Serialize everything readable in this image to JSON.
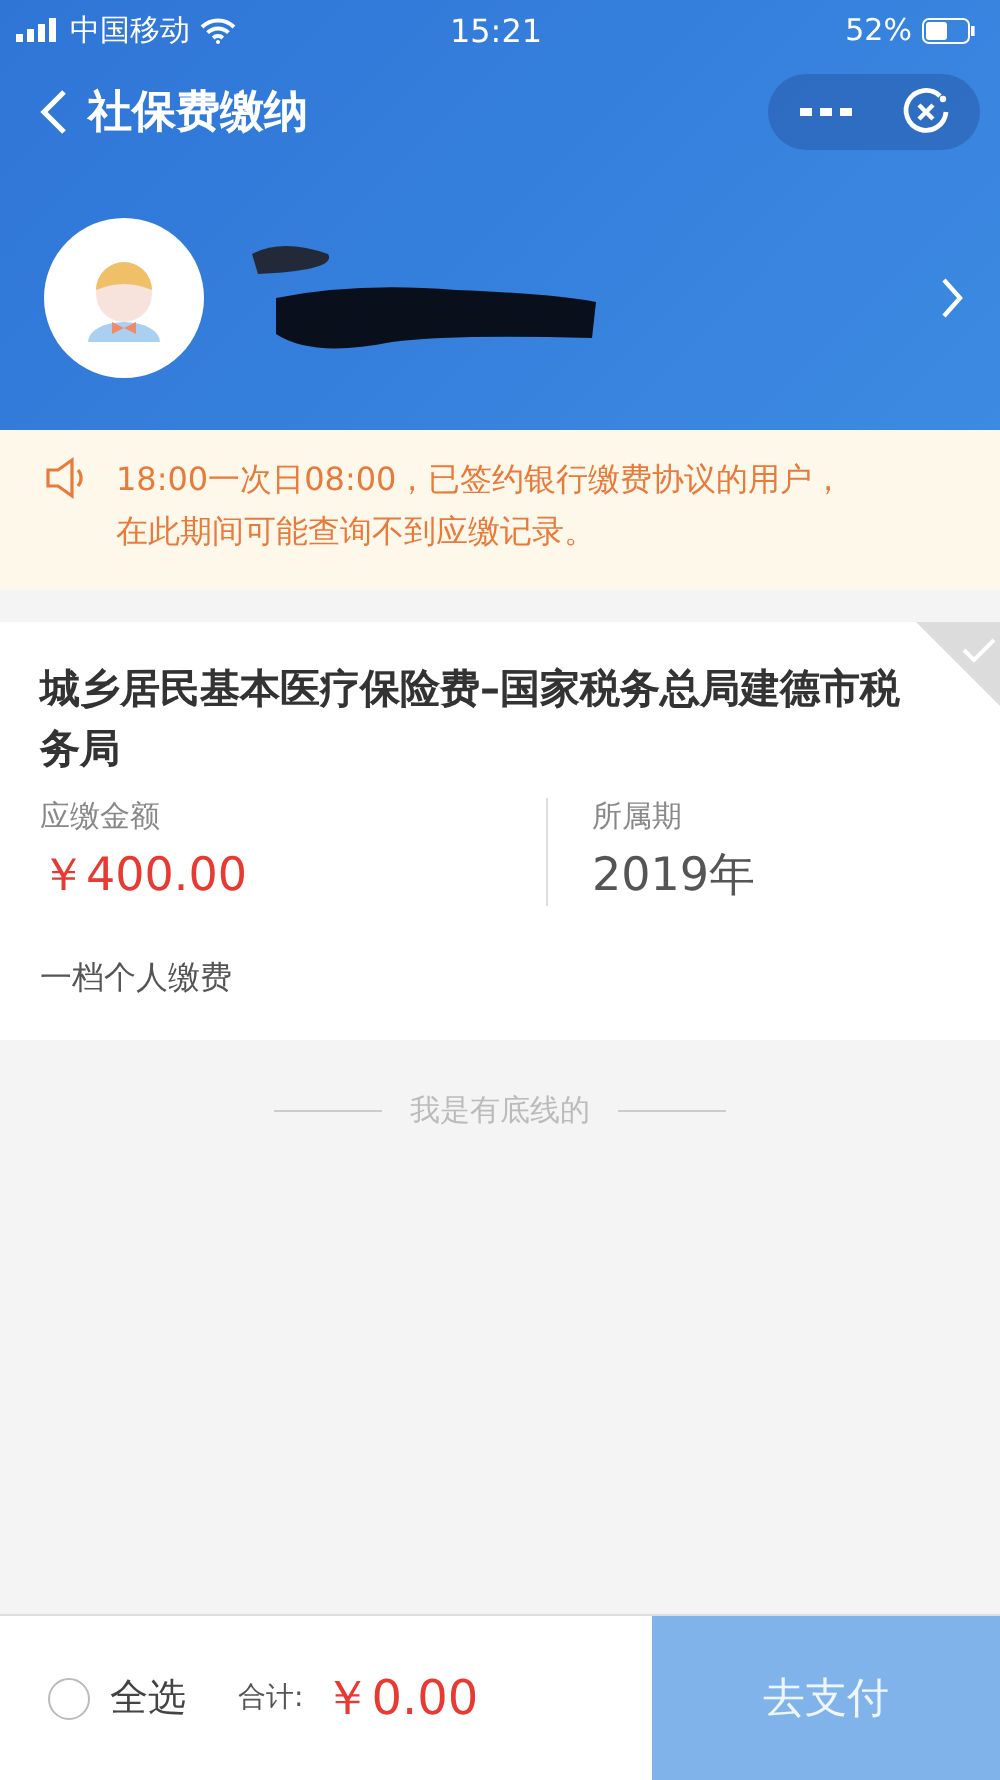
{
  "status_bar": {
    "carrier": "中国移动",
    "time": "15:21",
    "battery": "52%"
  },
  "nav": {
    "title": "社保费缴纳"
  },
  "notice": {
    "text": "18:00一次日08:00，已签约银行缴费协议的用户，在此期间可能查询不到应缴记录。"
  },
  "bills": [
    {
      "title": "城乡居民基本医疗保险费–国家税务总局建德市税务局",
      "amount_label": "应缴金额",
      "amount": "￥400.00",
      "period_label": "所属期",
      "period": "2019年",
      "note": "一档个人缴费",
      "selected": false
    }
  ],
  "end_text": "我是有底线的",
  "footer": {
    "select_all": {
      "label": "全选",
      "checked": false
    },
    "total_label": "合计:",
    "total": "￥0.00",
    "pay_button": {
      "label": "去支付",
      "disabled": true
    }
  }
}
